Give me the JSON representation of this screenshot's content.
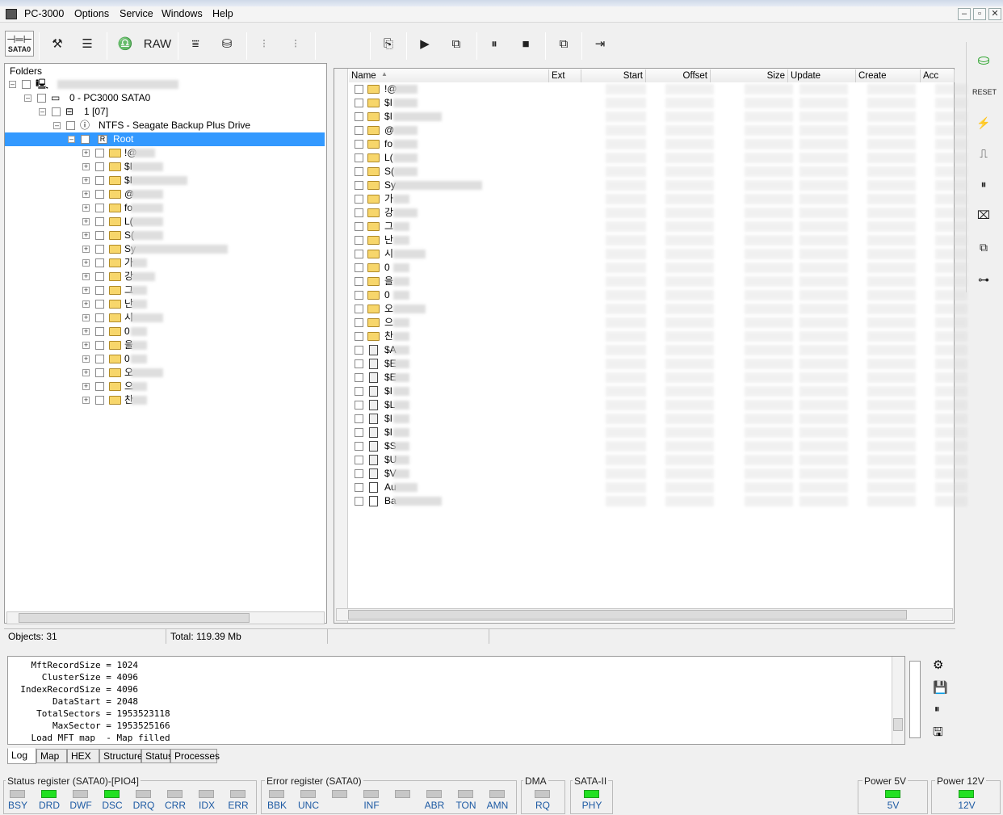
{
  "app": {
    "title": "PC-3000"
  },
  "menu": [
    "Options",
    "Service",
    "Windows",
    "Help"
  ],
  "toolbar": {
    "port_label": "SATA0",
    "raw_label": "RAW"
  },
  "tree": {
    "header": "Folders",
    "device": "0 - PC3000 SATA0",
    "partition": "1 [07]",
    "volume": "NTFS - Seagate Backup Plus Drive",
    "root": "Root",
    "root_badge": "R",
    "children": [
      "!@",
      "$I",
      "$I",
      "@",
      "fo",
      "L(",
      "S(",
      "Sy",
      "가",
      "강",
      "그",
      "난",
      "시",
      "0",
      "을",
      "0",
      "오",
      "으",
      "찬"
    ]
  },
  "list": {
    "columns": [
      "Name",
      "Ext",
      "Start",
      "Offset",
      "Size",
      "Update",
      "Create",
      "Acc"
    ],
    "rows": [
      {
        "name": "!@",
        "type": "folder"
      },
      {
        "name": "$I",
        "type": "folder"
      },
      {
        "name": "$I",
        "type": "folder"
      },
      {
        "name": "@",
        "type": "folder"
      },
      {
        "name": "fo",
        "type": "folder"
      },
      {
        "name": "L(",
        "type": "folder"
      },
      {
        "name": "S(",
        "type": "folder"
      },
      {
        "name": "Sy",
        "type": "folder"
      },
      {
        "name": "가",
        "type": "folder"
      },
      {
        "name": "강",
        "type": "folder"
      },
      {
        "name": "그",
        "type": "folder"
      },
      {
        "name": "난",
        "type": "folder"
      },
      {
        "name": "시",
        "type": "folder"
      },
      {
        "name": "0",
        "type": "folder"
      },
      {
        "name": "을",
        "type": "folder"
      },
      {
        "name": "0",
        "type": "folder"
      },
      {
        "name": "오",
        "type": "folder"
      },
      {
        "name": "으",
        "type": "folder"
      },
      {
        "name": "찬",
        "type": "folder"
      },
      {
        "name": "$A",
        "type": "sysfile"
      },
      {
        "name": "$E",
        "type": "sysfile"
      },
      {
        "name": "$E",
        "type": "sysfile"
      },
      {
        "name": "$I",
        "type": "sysfile"
      },
      {
        "name": "$L",
        "type": "sysfile"
      },
      {
        "name": "$I",
        "type": "sysfile"
      },
      {
        "name": "$I",
        "type": "sysfile"
      },
      {
        "name": "$S",
        "type": "sysfile"
      },
      {
        "name": "$U",
        "type": "sysfile"
      },
      {
        "name": "$V",
        "type": "sysfile"
      },
      {
        "name": "Au",
        "type": "gearfile"
      },
      {
        "name": "Ba",
        "type": "file"
      }
    ]
  },
  "status": {
    "objects": "Objects: 31",
    "total": "Total: 119.39 Mb"
  },
  "log": {
    "lines": [
      "    MftRecordSize = 1024",
      "      ClusterSize = 4096",
      "  IndexRecordSize = 4096",
      "        DataStart = 2048",
      "     TotalSectors = 1953523118",
      "        MaxSector = 1953525166",
      "    Load MFT map  - Map filled"
    ]
  },
  "tabs": [
    "Log",
    "Map",
    "HEX",
    "Structure",
    "Status",
    "Processes"
  ],
  "registers": {
    "status_title": "Status register (SATA0)-[PIO4]",
    "status_leds": [
      {
        "label": "BSY",
        "on": false
      },
      {
        "label": "DRD",
        "on": true
      },
      {
        "label": "DWF",
        "on": false
      },
      {
        "label": "DSC",
        "on": true
      },
      {
        "label": "DRQ",
        "on": false
      },
      {
        "label": "CRR",
        "on": false
      },
      {
        "label": "IDX",
        "on": false
      },
      {
        "label": "ERR",
        "on": false
      }
    ],
    "error_title": "Error register (SATA0)",
    "error_leds": [
      {
        "label": "BBK",
        "on": false
      },
      {
        "label": "UNC",
        "on": false
      },
      {
        "label": "",
        "on": false
      },
      {
        "label": "INF",
        "on": false
      },
      {
        "label": "",
        "on": false
      },
      {
        "label": "ABR",
        "on": false
      },
      {
        "label": "TON",
        "on": false
      },
      {
        "label": "AMN",
        "on": false
      }
    ],
    "dma_title": "DMA",
    "dma_led": {
      "label": "RQ",
      "on": false
    },
    "sata_title": "SATA-II",
    "sata_led": {
      "label": "PHY",
      "on": true
    },
    "power5_title": "Power 5V",
    "power5_led": {
      "label": "5V",
      "on": true
    },
    "power12_title": "Power 12V",
    "power12_led": {
      "label": "12V",
      "on": true
    }
  },
  "colors": {
    "selection": "#3399ff",
    "led_on": "#22e022",
    "led_label": "#1d5aa3"
  }
}
